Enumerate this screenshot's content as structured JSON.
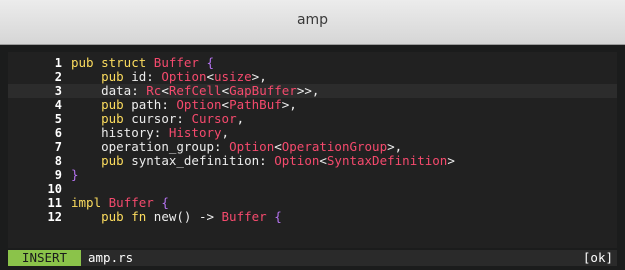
{
  "window": {
    "title": "amp"
  },
  "editor": {
    "lines": [
      {
        "n": "1",
        "tokens": [
          [
            "keyword",
            "pub struct "
          ],
          [
            "type",
            "Buffer"
          ],
          [
            "plain",
            " "
          ],
          [
            "brace",
            "{"
          ]
        ]
      },
      {
        "n": "2",
        "tokens": [
          [
            "plain",
            "    "
          ],
          [
            "keyword",
            "pub "
          ],
          [
            "ident",
            "id"
          ],
          [
            "punct",
            ": "
          ],
          [
            "type",
            "Option"
          ],
          [
            "punct",
            "<"
          ],
          [
            "type",
            "usize"
          ],
          [
            "punct",
            ">,"
          ]
        ]
      },
      {
        "n": "3",
        "tokens": [
          [
            "plain",
            "    "
          ],
          [
            "ident",
            "data"
          ],
          [
            "punct",
            ": "
          ],
          [
            "type",
            "Rc"
          ],
          [
            "punct",
            "<"
          ],
          [
            "type",
            "RefCell"
          ],
          [
            "punct",
            "<"
          ],
          [
            "type",
            "GapBuffer"
          ],
          [
            "punct",
            ">>,"
          ]
        ],
        "cursor": true
      },
      {
        "n": "4",
        "tokens": [
          [
            "plain",
            "    "
          ],
          [
            "keyword",
            "pub "
          ],
          [
            "ident",
            "path"
          ],
          [
            "punct",
            ": "
          ],
          [
            "type",
            "Option"
          ],
          [
            "punct",
            "<"
          ],
          [
            "type",
            "PathBuf"
          ],
          [
            "punct",
            ">,"
          ]
        ]
      },
      {
        "n": "5",
        "tokens": [
          [
            "plain",
            "    "
          ],
          [
            "keyword",
            "pub "
          ],
          [
            "ident",
            "cursor"
          ],
          [
            "punct",
            ": "
          ],
          [
            "type",
            "Cursor"
          ],
          [
            "punct",
            ","
          ]
        ]
      },
      {
        "n": "6",
        "tokens": [
          [
            "plain",
            "    "
          ],
          [
            "ident",
            "history"
          ],
          [
            "punct",
            ": "
          ],
          [
            "type",
            "History"
          ],
          [
            "punct",
            ","
          ]
        ]
      },
      {
        "n": "7",
        "tokens": [
          [
            "plain",
            "    "
          ],
          [
            "ident",
            "operation_group"
          ],
          [
            "punct",
            ": "
          ],
          [
            "type",
            "Option"
          ],
          [
            "punct",
            "<"
          ],
          [
            "type",
            "OperationGroup"
          ],
          [
            "punct",
            ">,"
          ]
        ]
      },
      {
        "n": "8",
        "tokens": [
          [
            "plain",
            "    "
          ],
          [
            "keyword",
            "pub "
          ],
          [
            "ident",
            "syntax_definition"
          ],
          [
            "punct",
            ": "
          ],
          [
            "type",
            "Option"
          ],
          [
            "punct",
            "<"
          ],
          [
            "type",
            "SyntaxDefinition"
          ],
          [
            "punct",
            ">"
          ]
        ]
      },
      {
        "n": "9",
        "tokens": [
          [
            "brace",
            "}"
          ]
        ]
      },
      {
        "n": "10",
        "tokens": []
      },
      {
        "n": "11",
        "tokens": [
          [
            "keyword",
            "impl "
          ],
          [
            "type",
            "Buffer"
          ],
          [
            "plain",
            " "
          ],
          [
            "brace",
            "{"
          ]
        ]
      },
      {
        "n": "12",
        "tokens": [
          [
            "plain",
            "    "
          ],
          [
            "keyword",
            "pub fn "
          ],
          [
            "ident",
            "new"
          ],
          [
            "punct",
            "() -> "
          ],
          [
            "type",
            "Buffer"
          ],
          [
            "plain",
            " "
          ],
          [
            "brace",
            "{"
          ]
        ]
      }
    ]
  },
  "status": {
    "mode": "INSERT",
    "filename": "amp.rs",
    "state": "[ok]"
  },
  "colors": {
    "mode_bg": "#8bc34a",
    "keyword": "#fcdc5e",
    "type": "#f54a6d",
    "brace": "#b573f0"
  }
}
